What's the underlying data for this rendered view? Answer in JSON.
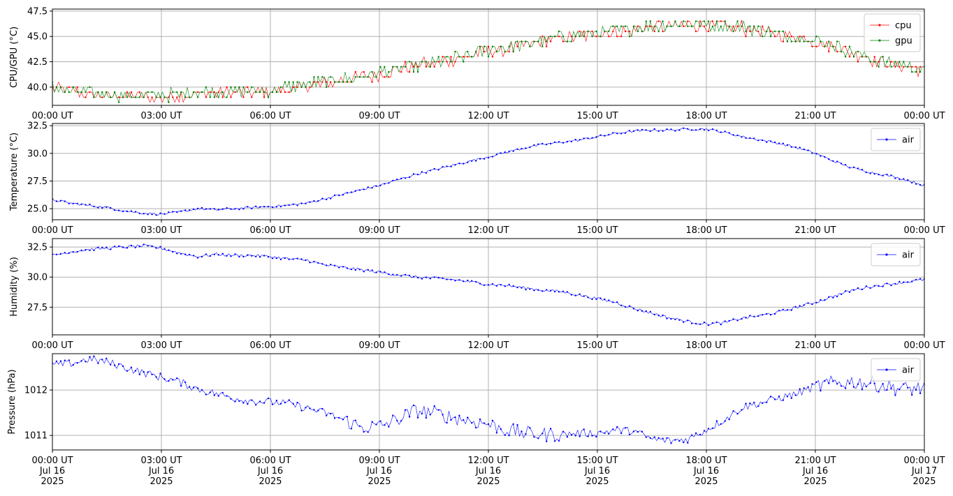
{
  "chart_data": [
    {
      "type": "line",
      "ylabel": "CPU/GPU (°C)",
      "ylim": [
        38.2,
        47.7
      ],
      "yticks": [
        "40.0",
        "42.5",
        "45.0",
        "47.5"
      ],
      "yticks_values": [
        40.0,
        42.5,
        45.0,
        47.5
      ],
      "xticks": [
        "00:00 UT",
        "03:00 UT",
        "06:00 UT",
        "09:00 UT",
        "12:00 UT",
        "15:00 UT",
        "18:00 UT",
        "21:00 UT",
        "00:00 UT"
      ],
      "xticks_values": [
        0,
        3,
        6,
        9,
        12,
        15,
        18,
        21,
        24
      ],
      "x_unit": "hours UT, Jul 16 2025",
      "grid": true,
      "legend_position": "top-right",
      "series": [
        {
          "name": "cpu",
          "color": "#ff0000",
          "x": [
            0,
            0.5,
            1,
            1.5,
            2,
            2.5,
            3,
            3.5,
            4,
            4.5,
            5,
            5.5,
            6,
            6.5,
            7,
            7.5,
            8,
            8.5,
            9,
            9.5,
            10,
            10.5,
            11,
            11.5,
            12,
            12.5,
            13,
            13.5,
            14,
            14.5,
            15,
            15.5,
            16,
            16.5,
            17,
            17.5,
            18,
            18.5,
            19,
            19.5,
            20,
            20.5,
            21,
            21.5,
            22,
            22.5,
            23,
            23.5,
            24
          ],
          "values": [
            40.0,
            39.6,
            39.3,
            39.2,
            39.1,
            39.0,
            39.0,
            39.1,
            39.3,
            39.4,
            39.4,
            39.5,
            39.6,
            39.8,
            40.0,
            40.3,
            40.6,
            40.9,
            41.3,
            41.7,
            42.1,
            42.4,
            42.7,
            43.1,
            43.5,
            43.8,
            44.1,
            44.5,
            44.8,
            45.0,
            45.2,
            45.4,
            45.7,
            45.9,
            46.0,
            46.1,
            46.1,
            46.0,
            45.8,
            45.5,
            45.2,
            45.0,
            44.5,
            44.0,
            43.4,
            42.8,
            42.3,
            42.0,
            41.6
          ]
        },
        {
          "name": "gpu",
          "color": "#008000",
          "x": [
            0,
            0.5,
            1,
            1.5,
            2,
            2.5,
            3,
            3.5,
            4,
            4.5,
            5,
            5.5,
            6,
            6.5,
            7,
            7.5,
            8,
            8.5,
            9,
            9.5,
            10,
            10.5,
            11,
            11.5,
            12,
            12.5,
            13,
            13.5,
            14,
            14.5,
            15,
            15.5,
            16,
            16.5,
            17,
            17.5,
            18,
            18.5,
            19,
            19.5,
            20,
            20.5,
            21,
            21.5,
            22,
            22.5,
            23,
            23.5,
            24
          ],
          "values": [
            39.9,
            39.6,
            39.4,
            39.3,
            39.2,
            39.2,
            39.2,
            39.3,
            39.5,
            39.5,
            39.6,
            39.6,
            39.7,
            40.0,
            40.3,
            40.6,
            40.8,
            41.1,
            41.4,
            41.8,
            42.1,
            42.4,
            42.8,
            43.2,
            43.6,
            43.9,
            44.2,
            44.6,
            44.9,
            45.1,
            45.3,
            45.5,
            45.8,
            46.0,
            46.1,
            46.2,
            46.2,
            46.1,
            45.9,
            45.6,
            45.3,
            45.0,
            44.6,
            44.1,
            43.5,
            42.9,
            42.4,
            42.1,
            41.7
          ]
        }
      ]
    },
    {
      "type": "line",
      "ylabel": "Temperature (°C)",
      "ylim": [
        24.0,
        32.7
      ],
      "yticks": [
        "25.0",
        "27.5",
        "30.0",
        "32.5"
      ],
      "yticks_values": [
        25.0,
        27.5,
        30.0,
        32.5
      ],
      "xticks": [
        "00:00 UT",
        "03:00 UT",
        "06:00 UT",
        "09:00 UT",
        "12:00 UT",
        "15:00 UT",
        "18:00 UT",
        "21:00 UT",
        "00:00 UT"
      ],
      "xticks_values": [
        0,
        3,
        6,
        9,
        12,
        15,
        18,
        21,
        24
      ],
      "grid": true,
      "legend_position": "top-right",
      "series": [
        {
          "name": "air",
          "color": "#0000ff",
          "x": [
            0,
            0.5,
            1,
            1.5,
            2,
            2.5,
            3,
            3.5,
            4,
            4.5,
            5,
            5.5,
            6,
            6.5,
            7,
            7.5,
            8,
            8.5,
            9,
            9.5,
            10,
            10.5,
            11,
            11.5,
            12,
            12.5,
            13,
            13.5,
            14,
            14.5,
            15,
            15.5,
            16,
            16.5,
            17,
            17.5,
            18,
            18.5,
            19,
            19.5,
            20,
            20.5,
            21,
            21.5,
            22,
            22.5,
            23,
            23.5,
            24
          ],
          "values": [
            25.8,
            25.5,
            25.3,
            25.1,
            24.8,
            24.6,
            24.5,
            24.7,
            25.0,
            24.9,
            25.0,
            25.1,
            25.2,
            25.3,
            25.5,
            25.9,
            26.3,
            26.7,
            27.1,
            27.6,
            28.1,
            28.5,
            28.9,
            29.3,
            29.7,
            30.1,
            30.5,
            30.8,
            31.0,
            31.2,
            31.5,
            31.8,
            32.0,
            32.1,
            32.1,
            32.2,
            32.2,
            31.9,
            31.5,
            31.2,
            30.9,
            30.5,
            30.0,
            29.3,
            28.7,
            28.3,
            28.0,
            27.6,
            27.1
          ]
        }
      ]
    },
    {
      "type": "line",
      "ylabel": "Humidity (%)",
      "ylim": [
        25.2,
        33.2
      ],
      "yticks": [
        "27.5",
        "30.0",
        "32.5"
      ],
      "yticks_values": [
        27.5,
        30.0,
        32.5
      ],
      "xticks": [
        "00:00 UT",
        "03:00 UT",
        "06:00 UT",
        "09:00 UT",
        "12:00 UT",
        "15:00 UT",
        "18:00 UT",
        "21:00 UT",
        "00:00 UT"
      ],
      "xticks_values": [
        0,
        3,
        6,
        9,
        12,
        15,
        18,
        21,
        24
      ],
      "grid": true,
      "legend_position": "top-right",
      "series": [
        {
          "name": "air",
          "color": "#0000ff",
          "x": [
            0,
            0.5,
            1,
            1.5,
            2,
            2.5,
            3,
            3.5,
            4,
            4.5,
            5,
            5.5,
            6,
            6.5,
            7,
            7.5,
            8,
            8.5,
            9,
            9.5,
            10,
            10.5,
            11,
            11.5,
            12,
            12.5,
            13,
            13.5,
            14,
            14.5,
            15,
            15.5,
            16,
            16.5,
            17,
            17.5,
            18,
            18.5,
            19,
            19.5,
            20,
            20.5,
            21,
            21.5,
            22,
            22.5,
            23,
            23.5,
            24
          ],
          "values": [
            31.8,
            32.1,
            32.3,
            32.4,
            32.5,
            32.6,
            32.4,
            32.0,
            31.7,
            31.9,
            31.8,
            31.8,
            31.7,
            31.5,
            31.4,
            31.0,
            30.8,
            30.6,
            30.4,
            30.2,
            30.0,
            29.9,
            29.8,
            29.6,
            29.4,
            29.3,
            29.1,
            28.9,
            28.8,
            28.5,
            28.2,
            27.9,
            27.4,
            27.0,
            26.6,
            26.3,
            26.1,
            26.2,
            26.6,
            26.8,
            27.1,
            27.5,
            27.9,
            28.4,
            28.9,
            29.2,
            29.4,
            29.6,
            29.8
          ]
        }
      ]
    },
    {
      "type": "line",
      "ylabel": "Pressure (hPa)",
      "ylim": [
        1010.68,
        1012.8
      ],
      "yticks": [
        "1011",
        "1012"
      ],
      "yticks_values": [
        1011,
        1012
      ],
      "xticks": [
        "00:00 UT\nJul 16\n2025",
        "03:00 UT\nJul 16\n2025",
        "06:00 UT\nJul 16\n2025",
        "09:00 UT\nJul 16\n2025",
        "12:00 UT\nJul 16\n2025",
        "15:00 UT\nJul 16\n2025",
        "18:00 UT\nJul 16\n2025",
        "21:00 UT\nJul 16\n2025",
        "00:00 UT\nJul 17\n2025"
      ],
      "xticks_values": [
        0,
        3,
        6,
        9,
        12,
        15,
        18,
        21,
        24
      ],
      "grid": true,
      "legend_position": "top-right",
      "series": [
        {
          "name": "air",
          "color": "#0000ff",
          "x": [
            0,
            0.5,
            1,
            1.5,
            2,
            2.5,
            3,
            3.5,
            4,
            4.5,
            5,
            5.5,
            6,
            6.5,
            7,
            7.5,
            8,
            8.5,
            9,
            9.5,
            10,
            10.5,
            11,
            11.5,
            12,
            12.5,
            13,
            13.5,
            14,
            14.5,
            15,
            15.5,
            16,
            16.5,
            17,
            17.5,
            18,
            18.5,
            19,
            19.5,
            20,
            20.5,
            21,
            21.5,
            22,
            22.5,
            23,
            23.5,
            24
          ],
          "values": [
            1012.55,
            1012.58,
            1012.68,
            1012.62,
            1012.5,
            1012.38,
            1012.28,
            1012.18,
            1012.02,
            1011.92,
            1011.82,
            1011.76,
            1011.74,
            1011.7,
            1011.6,
            1011.5,
            1011.35,
            1011.18,
            1011.2,
            1011.35,
            1011.55,
            1011.5,
            1011.4,
            1011.32,
            1011.25,
            1011.12,
            1011.05,
            1011.02,
            1011.02,
            1011.05,
            1011.05,
            1011.12,
            1011.1,
            1010.92,
            1010.88,
            1010.92,
            1011.12,
            1011.35,
            1011.62,
            1011.72,
            1011.82,
            1011.92,
            1012.08,
            1012.15,
            1012.18,
            1012.15,
            1012.08,
            1012.02,
            1012.05
          ]
        }
      ]
    }
  ]
}
